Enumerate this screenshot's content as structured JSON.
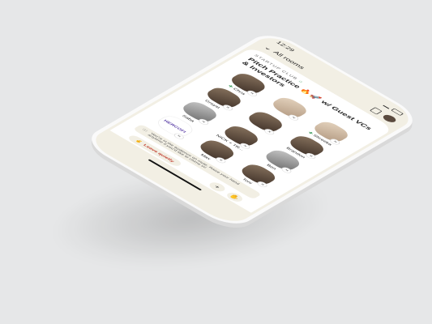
{
  "status": {
    "time": "12:29"
  },
  "nav": {
    "back_label": "All rooms"
  },
  "room": {
    "club": "STARTUP CLUB",
    "title": "Pitch Practice 🔥🚀 w/ Guest VCs & Investors"
  },
  "speakers": [
    {
      "name": "Chris",
      "moderator": true,
      "tone": "dark"
    },
    {
      "name": "",
      "moderator": false,
      "tone": "light"
    },
    {
      "name": "Shreeka",
      "moderator": true,
      "tone": "light"
    },
    {
      "name": "Greyst",
      "moderator": false,
      "tone": "dark"
    },
    {
      "name": "",
      "moderator": false,
      "tone": "dark"
    },
    {
      "name": "Brandon",
      "moderator": false,
      "tone": "dark"
    },
    {
      "name": "Saba",
      "moderator": false,
      "tone": "gray"
    },
    {
      "name": "NICK + TR...",
      "moderator": false,
      "tone": "dark"
    },
    {
      "name": "Ben",
      "moderator": false,
      "tone": "gray"
    },
    {
      "name": "",
      "moderator": false,
      "tone": "logo"
    },
    {
      "name": "Max",
      "moderator": false,
      "tone": "dark"
    },
    {
      "name": "Toni",
      "moderator": false,
      "tone": "dark"
    }
  ],
  "logo_text": "HERCOFI",
  "notice": {
    "text": "You're in the audience on mute. Raise your hand anytime if you'd like to chime in!"
  },
  "actions": {
    "leave_label": "Leave quietly",
    "add_symbol": "+",
    "raise_symbol": "✋"
  },
  "icons": {
    "back": "chevron-down-icon",
    "doc": "document-icon",
    "mute": "mic-off-icon",
    "peace": "peace-hand-icon",
    "hand": "raise-hand-icon",
    "house": "house-icon"
  }
}
